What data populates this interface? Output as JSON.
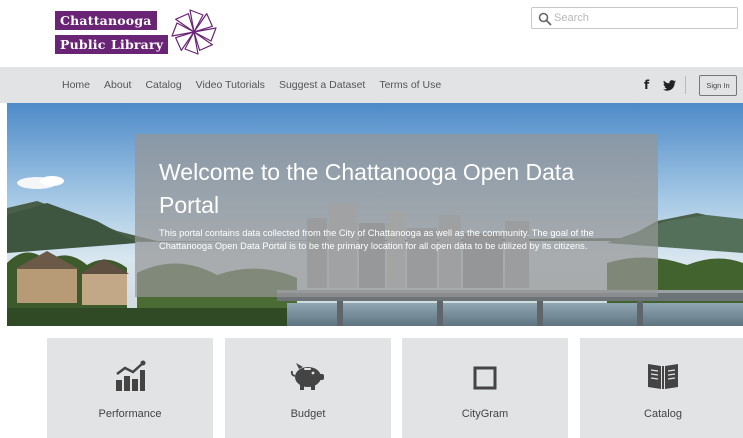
{
  "logo": {
    "word1": "Chattanooga",
    "word2": "Public",
    "word3": "Library",
    "icon": "pinwheel-flower-icon"
  },
  "search": {
    "placeholder": "Search",
    "icon": "search-icon"
  },
  "nav": {
    "items": [
      "Home",
      "About",
      "Catalog",
      "Video Tutorials",
      "Suggest a Dataset",
      "Terms of Use"
    ],
    "facebook_label": "f",
    "signin_label": "Sign In"
  },
  "hero": {
    "title": "Welcome to the Chattanooga Open Data Portal",
    "text": "This portal contains data collected from the City of Chattanooga as well as the community. The goal of the Chattanooga Open Data Portal is to be the primary location for all open data to be utilized by its citizens."
  },
  "tiles": [
    {
      "label": "Performance",
      "icon": "bar-chart-trend-icon"
    },
    {
      "label": "Budget",
      "icon": "piggy-bank-icon"
    },
    {
      "label": "CityGram",
      "icon": "square-outline-icon"
    },
    {
      "label": "Catalog",
      "icon": "open-book-icon"
    }
  ],
  "colors": {
    "brand_purple": "#6a2476",
    "nav_bg": "#e1e3e5",
    "tile_bg": "#e1e3e5"
  }
}
